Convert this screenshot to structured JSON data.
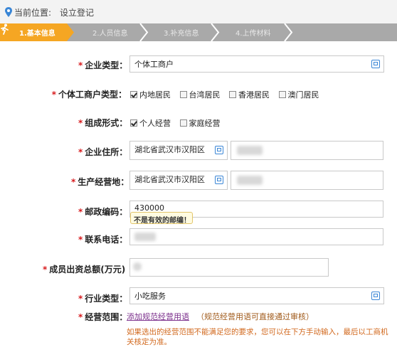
{
  "location": {
    "label": "当前位置:",
    "value": "设立登记"
  },
  "steps": [
    {
      "label": "1.基本信息",
      "active": true
    },
    {
      "label": "2.人员信息",
      "active": false
    },
    {
      "label": "3.补充信息",
      "active": false
    },
    {
      "label": "4.上传材料",
      "active": false
    }
  ],
  "form": {
    "enterprise_type": {
      "label": "企业类型：",
      "value": "个体工商户"
    },
    "individual_type": {
      "label": "个体工商户类型：",
      "options": [
        {
          "label": "内地居民",
          "checked": true
        },
        {
          "label": "台湾居民",
          "checked": false
        },
        {
          "label": "香港居民",
          "checked": false
        },
        {
          "label": "澳门居民",
          "checked": false
        }
      ]
    },
    "org_form": {
      "label": "组成形式：",
      "options": [
        {
          "label": "个人经营",
          "checked": true
        },
        {
          "label": "家庭经营",
          "checked": false
        }
      ]
    },
    "address": {
      "label": "企业住所：",
      "value": "湖北省武汉市汉阳区"
    },
    "business_address": {
      "label": "生产经营地：",
      "value": "湖北省武汉市汉阳区"
    },
    "postcode": {
      "label": "邮政编码：",
      "value": "430000",
      "error": "不是有效的邮编！"
    },
    "phone": {
      "label": "联系电话："
    },
    "capital": {
      "label": "成员出资总额(万元) ："
    },
    "industry": {
      "label": "行业类型：",
      "value": "小吃服务"
    },
    "scope": {
      "label": "经营范围：",
      "link": "添加规范经营用语",
      "hint": "（规范经营用语可直接通过审核）",
      "note": "如果选出的经营范围不能满足您的要求，您可以在下方手动输入，最后以工商机关核定为准。"
    }
  },
  "colors": {
    "active_step": "#f5a623",
    "inactive_step": "#a9a9a9",
    "required": "#d7191c",
    "note": "#d2691e"
  }
}
